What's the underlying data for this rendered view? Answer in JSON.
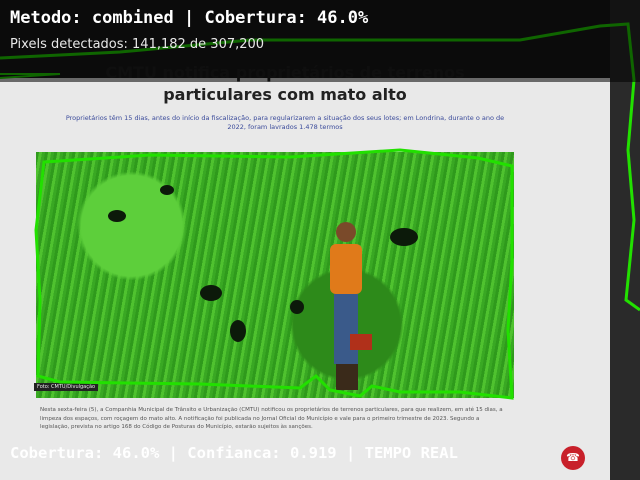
{
  "overlay": {
    "status_line": "Metodo: combined | Cobertura: 46.0%",
    "pixels_line": "Pixels detectados: 141,182 de 307,200",
    "footer_line": "Cobertura: 46.0% | Confianca: 0.919 | TEMPO REAL"
  },
  "detection": {
    "method": "combined",
    "coverage_percent": 46.0,
    "pixels_detected": 141182,
    "pixels_total": 307200,
    "confidence": 0.919,
    "mode": "TEMPO REAL",
    "outline_color": "#22e000"
  },
  "article": {
    "title": "CMTU notifica proprietários de terrenos particulares com mato alto",
    "lead": "Proprietários têm 15 dias, antes do início da fiscalização, para regularizarem a situação dos seus lotes; em Londrina, durante o ano de 2022, foram lavrados 1.478 termos",
    "photo_credit": "Foto: CMTU/Divulgação",
    "body": "Nesta sexta-feira (5), a Companhia Municipal de Trânsito e Urbanização (CMTU) notificou os proprietários de terrenos particulares, para que realizem, em até 15 dias, a limpeza dos espaços, com roçagem do mato alto. A notificação foi publicada no Jornal Oficial do Município e vale para o primeiro trimestre de 2023. Segundo a legislação, prevista no artigo 168 do Código de Posturas do Município, estarão sujeitos às sanções."
  },
  "record_button": {
    "icon": "phone-hangup-icon",
    "color": "#c8202a"
  }
}
